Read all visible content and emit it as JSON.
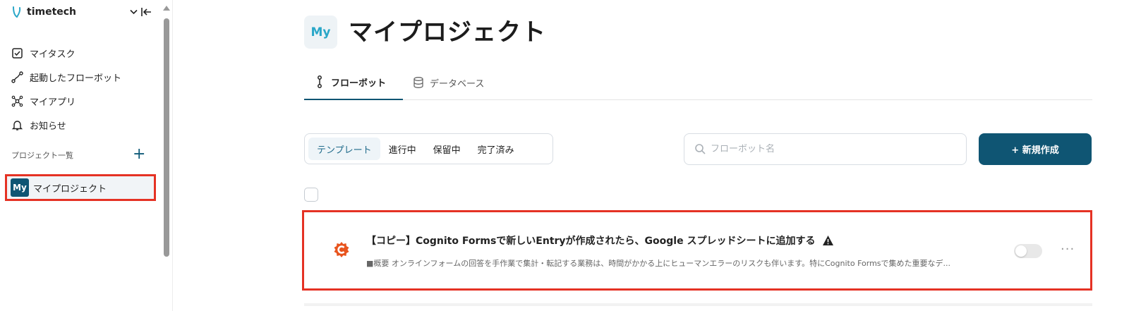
{
  "sidebar": {
    "brand": "timetech",
    "nav": [
      {
        "label": "マイタスク",
        "icon": "checkbox-icon"
      },
      {
        "label": "起動したフローボット",
        "icon": "flow-icon"
      },
      {
        "label": "マイアプリ",
        "icon": "apps-icon"
      },
      {
        "label": "お知らせ",
        "icon": "bell-icon"
      }
    ],
    "section_label": "プロジェクト一覧",
    "add_symbol": "+",
    "project": {
      "avatar": "My",
      "label": "マイプロジェクト"
    }
  },
  "main": {
    "avatar": "My",
    "title": "マイプロジェクト",
    "tabs": [
      {
        "label": "フローボット",
        "icon": "flowbot-icon"
      },
      {
        "label": "データベース",
        "icon": "database-icon"
      }
    ],
    "filters": [
      "テンプレート",
      "進行中",
      "保留中",
      "完了済み"
    ],
    "search": {
      "placeholder": "フローボット名",
      "value": ""
    },
    "new_button": "+ 新規作成",
    "card": {
      "title": "【コピー】Cognito Formsで新しいEntryが作成されたら、Google スプレッドシートに追加する",
      "description": "■概要 オンラインフォームの回答を手作業で集計・転記する業務は、時間がかかる上にヒューマンエラーのリスクも伴います。特にCognito Formsで集めた重要なデ...",
      "more": "···"
    }
  },
  "colors": {
    "primary": "#0f5573",
    "highlight": "#e53224",
    "cognito": "#e8541e",
    "avatar_text": "#2aa7c8"
  }
}
